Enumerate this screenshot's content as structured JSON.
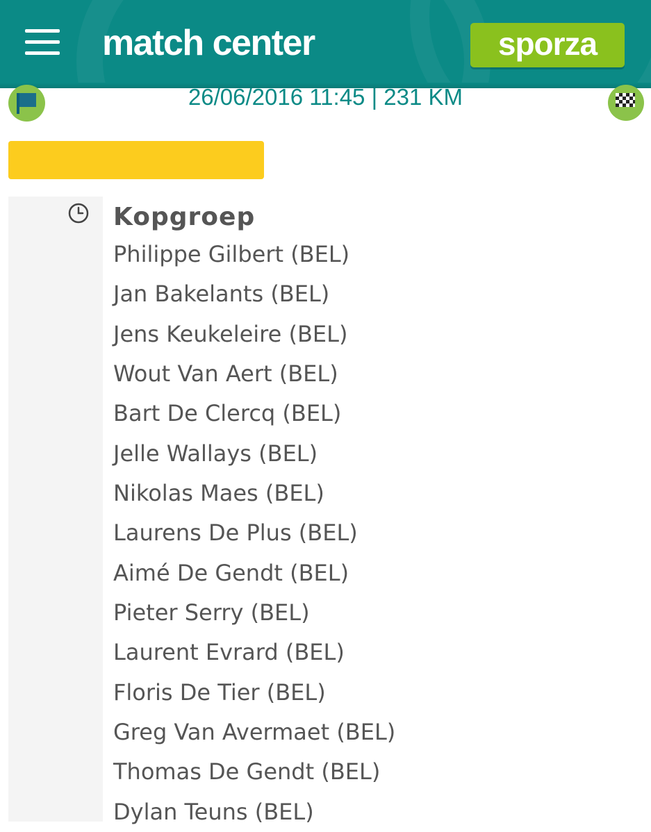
{
  "header": {
    "title": "match center",
    "brand": "sporza",
    "menu_icon": "hamburger-menu-icon",
    "background_color": "#0b8a86",
    "brand_color": "#8ac11e"
  },
  "race": {
    "info": "26/06/2016 11:45 | 231 KM",
    "start_icon": "start-flag-icon",
    "finish_icon": "finish-checkered-flag-icon"
  },
  "status_bar_color": "#fccc1e",
  "feed": {
    "clock_icon": "clock-icon",
    "group_title": "Kopgroep",
    "riders": [
      "Philippe Gilbert (BEL)",
      "Jan Bakelants (BEL)",
      "Jens Keukeleire (BEL)",
      "Wout Van Aert (BEL)",
      "Bart De Clercq (BEL)",
      "Jelle Wallays (BEL)",
      "Nikolas Maes (BEL)",
      "Laurens De Plus (BEL)",
      "Aimé De Gendt (BEL)",
      "Pieter Serry (BEL)",
      "Laurent Evrard (BEL)",
      "Floris De Tier (BEL)",
      "Greg Van Avermaet (BEL)",
      "Thomas De Gendt (BEL)",
      "Dylan Teuns (BEL)"
    ]
  }
}
